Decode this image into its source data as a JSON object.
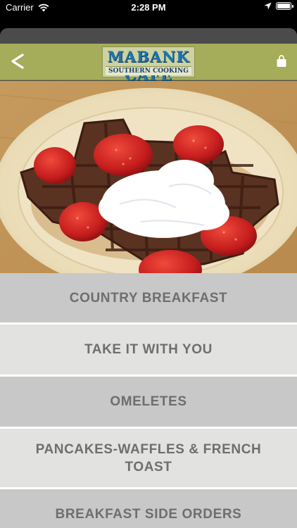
{
  "status_bar": {
    "carrier": "Carrier",
    "time": "2:28 PM"
  },
  "header": {
    "back_icon": "chevron-left-icon",
    "cart_icon": "shopping-bag-icon",
    "logo": {
      "title": "MABANK CAFE",
      "subtitle": "SOUTHERN COOKING"
    },
    "bar_color": "#a5ac5a"
  },
  "hero_image": {
    "subject": "Texas-shaped chocolate waffle with strawberries and whipped cream"
  },
  "menu": {
    "items": [
      {
        "label": "COUNTRY BREAKFAST"
      },
      {
        "label": "TAKE IT WITH YOU"
      },
      {
        "label": "OMELETES"
      },
      {
        "label": "PANCAKES-WAFFLES & FRENCH TOAST"
      },
      {
        "label": "BREAKFAST SIDE ORDERS"
      }
    ],
    "colors": {
      "dark": "#c8c8c8",
      "light": "#e2e3e1",
      "text": "#6e6e6e"
    }
  }
}
